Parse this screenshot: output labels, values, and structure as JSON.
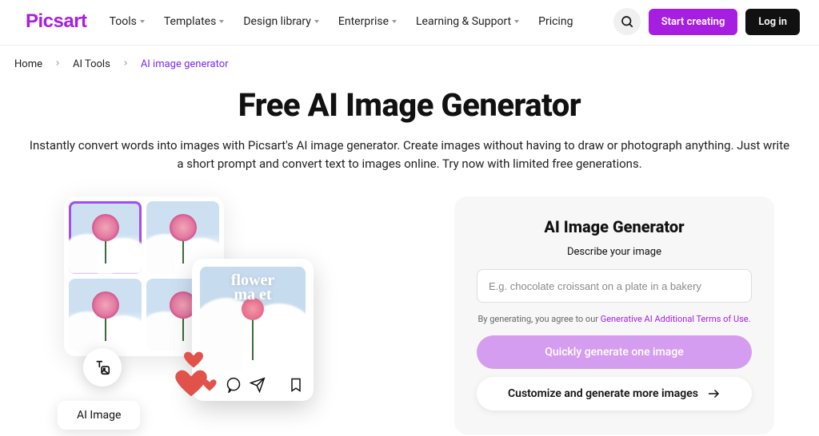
{
  "logo": "Picsart",
  "nav": {
    "items": [
      {
        "label": "Tools",
        "has_dropdown": true
      },
      {
        "label": "Templates",
        "has_dropdown": true
      },
      {
        "label": "Design library",
        "has_dropdown": true
      },
      {
        "label": "Enterprise",
        "has_dropdown": true
      },
      {
        "label": "Learning & Support",
        "has_dropdown": true
      },
      {
        "label": "Pricing",
        "has_dropdown": false
      }
    ]
  },
  "header": {
    "start_creating": "Start creating",
    "log_in": "Log in"
  },
  "breadcrumb": {
    "items": [
      "Home",
      "AI Tools"
    ],
    "current": "AI image generator"
  },
  "hero": {
    "title": "Free AI Image Generator",
    "subtitle": "Instantly convert words into images with Picsart's AI image generator. Create images without having to draw or photograph anything. Just write a short prompt and convert text to images online. Try now with limited free generations."
  },
  "illustration": {
    "social_overlay_line1": "flower",
    "social_overlay_line2": "ma   et",
    "ai_pill": "AI Image"
  },
  "panel": {
    "title": "AI Image Generator",
    "subtitle": "Describe your image",
    "placeholder": "E.g. chocolate croissant on a plate in a bakery",
    "terms_prefix": "By generating, you agree to our ",
    "terms_link": "Generative AI Additional Terms of Use.",
    "quick_button": "Quickly generate one image",
    "customize_button": "Customize and generate more images"
  }
}
